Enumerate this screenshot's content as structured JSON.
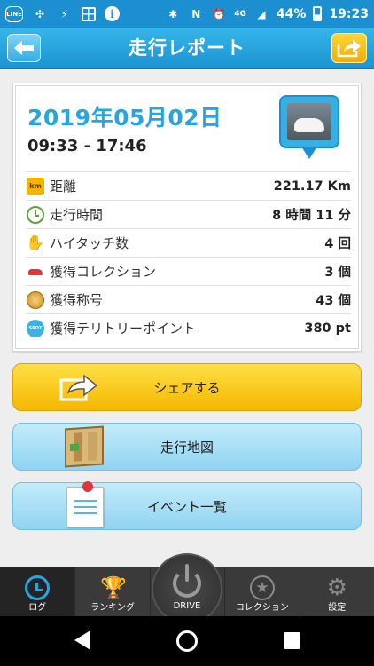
{
  "status_bar": {
    "line_label": "LINE",
    "network": "4G",
    "battery": "44%",
    "time": "19:23",
    "battery_level": 0.44
  },
  "header": {
    "title": "走行レポート",
    "back_icon": "back-arrow-icon",
    "share_icon": "share-icon"
  },
  "report": {
    "date": "2019年05月02日",
    "time_range": "09:33 - 17:46",
    "photo_icon": "car-photo-pin",
    "stats": [
      {
        "icon": "km-icon",
        "icon_text": "km",
        "label": "距離",
        "value": "221.17 Km"
      },
      {
        "icon": "clock-icon",
        "icon_text": "",
        "label": "走行時間",
        "value": "8 時間 11 分"
      },
      {
        "icon": "high-five-icon",
        "icon_text": "✋",
        "label": "ハイタッチ数",
        "value": "4 回"
      },
      {
        "icon": "car-collection-icon",
        "icon_text": "",
        "label": "獲得コレクション",
        "value": "3 個"
      },
      {
        "icon": "medal-icon",
        "icon_text": "",
        "label": "獲得称号",
        "value": "43 個"
      },
      {
        "icon": "territory-point-icon",
        "icon_text": "SPOT",
        "label": "獲得テリトリーポイント",
        "value": "380 pt"
      }
    ]
  },
  "actions": {
    "share_label": "シェアする",
    "map_label": "走行地図",
    "events_label": "イベント一覧"
  },
  "tabs": [
    {
      "label": "ログ",
      "icon": "log-clock-icon",
      "active": true
    },
    {
      "label": "ランキング",
      "icon": "trophy-icon",
      "active": false
    },
    {
      "label": "DRIVE",
      "icon": "power-icon",
      "active": false
    },
    {
      "label": "コレクション",
      "icon": "star-icon",
      "active": false
    },
    {
      "label": "設定",
      "icon": "gear-icon",
      "active": false
    }
  ],
  "colors": {
    "accent_blue": "#1c8fd0",
    "date_blue": "#24a7e0",
    "share_yellow": "#f5b800",
    "light_blue_button": "#8fd3f2",
    "tabbar": "#3a3a3a"
  }
}
